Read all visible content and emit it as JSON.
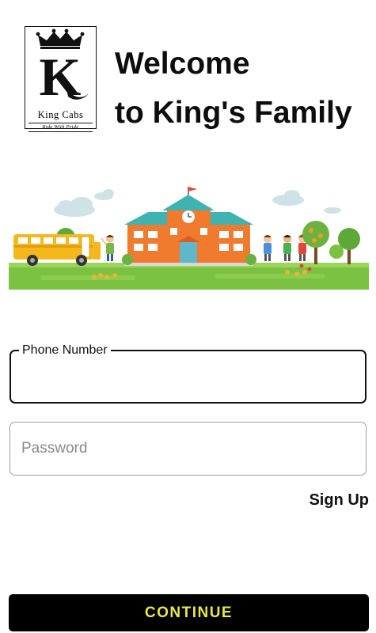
{
  "logo": {
    "letter": "K",
    "brand": "King Cabs",
    "tagline": "Ride With Pride",
    "icon": "crown-icon"
  },
  "header": {
    "line1": "Welcome",
    "line2": "to King's Family"
  },
  "illustration": {
    "name": "school-scene-illustration"
  },
  "form": {
    "phone": {
      "label": "Phone Number",
      "value": ""
    },
    "password": {
      "placeholder": "Password",
      "value": ""
    }
  },
  "signup_label": "Sign Up",
  "continue_label": "CONTINUE",
  "colors": {
    "button_bg": "#000000",
    "button_text": "#e8e84a",
    "ground": "#7bc142"
  }
}
